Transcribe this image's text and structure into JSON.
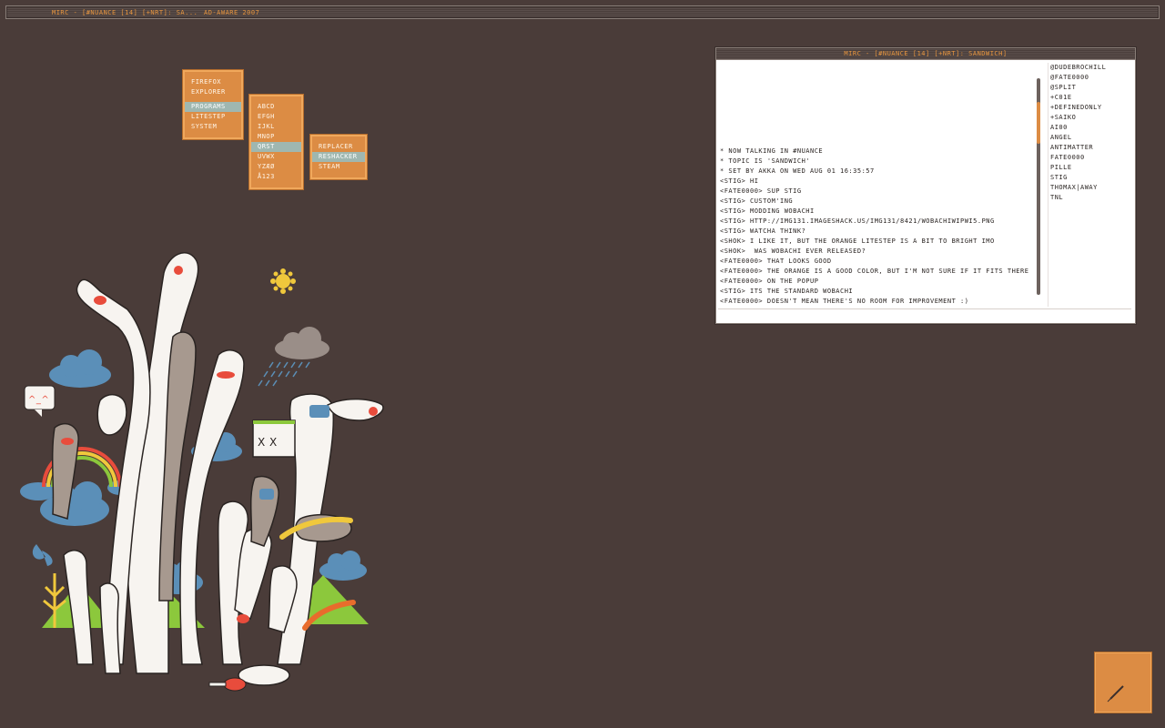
{
  "taskbar": {
    "tasks": [
      "mIRC - [#nuance [14] [+nrt]: sa...",
      "Ad-Aware 2007"
    ]
  },
  "menus": {
    "main": {
      "items": [
        "Firefox",
        "Explorer",
        "Programs",
        "Litestep",
        "System"
      ],
      "selected": "Programs"
    },
    "programs": {
      "items": [
        "ABCD",
        "EFGH",
        "IJKL",
        "MNOP",
        "QRST",
        "UVWX",
        "YZÆØ",
        "Å123"
      ],
      "selected": "QRST"
    },
    "qrst": {
      "items": [
        "Replacer",
        "ResHacker",
        "Steam"
      ],
      "selected": "ResHacker"
    }
  },
  "mirc": {
    "title": "mIRC - [#nuance [14] [+nrt]: sandwich]",
    "chat": [
      "* Now talking in #nuance",
      "* Topic is 'sandwich'",
      "* Set by akka on Wed Aug 01 16:35:57",
      "<stig> hi",
      "<fate0000> sup stig",
      "<stig> custom'ing",
      "<stig> modding wobachi",
      "<stig> http://img131.imageshack.us/img131/8421/wobachiwipwi5.png",
      "<stig> watcha think?",
      "<shok> i like it, but the orange litestep is a bit to bright imo",
      "<shok>  was wobachi ever released?",
      "<fate0000> that looks good",
      "<fate0000> the orange is a good color, but i'm not sure if it fits there",
      "<fate0000> on the popup",
      "<stig> its the standard wobachi",
      "<fate0000> doesn't mean there's no room for improvement :)"
    ],
    "nicks": [
      "@dudebrochill",
      "@fate0000",
      "@split",
      "+c01e",
      "+definedonly",
      "+saiko",
      "ai00",
      "angel",
      "antimatter",
      "fate0000",
      "pille",
      "stig",
      "thomax|away",
      "tnl"
    ],
    "input": ""
  },
  "colors": {
    "accent": "#dc8c44",
    "desktop": "#4a3c39",
    "selected": "#9fb7b0"
  }
}
